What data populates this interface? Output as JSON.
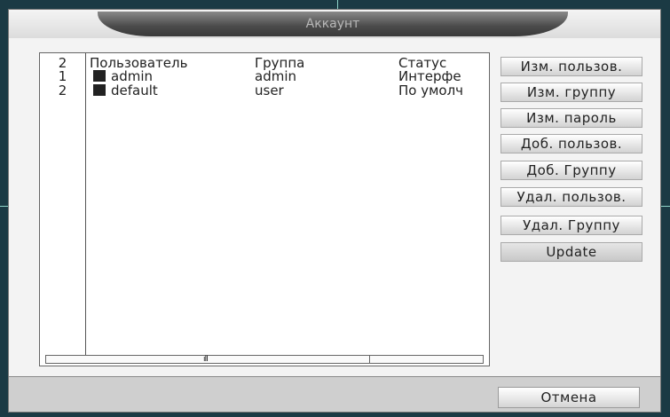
{
  "window": {
    "title": "Аккаунт"
  },
  "list": {
    "header": {
      "count": "2",
      "user": "Пользователь",
      "group": "Группа",
      "status": "Статус"
    },
    "rows": [
      {
        "num": "1",
        "user": "admin",
        "group": "admin",
        "status": "Интерфе"
      },
      {
        "num": "2",
        "user": "default",
        "group": "user",
        "status": "По умолч"
      }
    ],
    "scroll_grip": "ıII"
  },
  "buttons": {
    "modify_user": "Изм. пользов.",
    "modify_group": "Изм. группу",
    "modify_password": "Изм. пароль",
    "add_user": "Доб. пользов.",
    "add_group": "Доб. Группу",
    "delete_user": "Удал. пользов.",
    "delete_group": "Удал. Группу",
    "update": "Update"
  },
  "footer": {
    "cancel": "Отмена"
  }
}
